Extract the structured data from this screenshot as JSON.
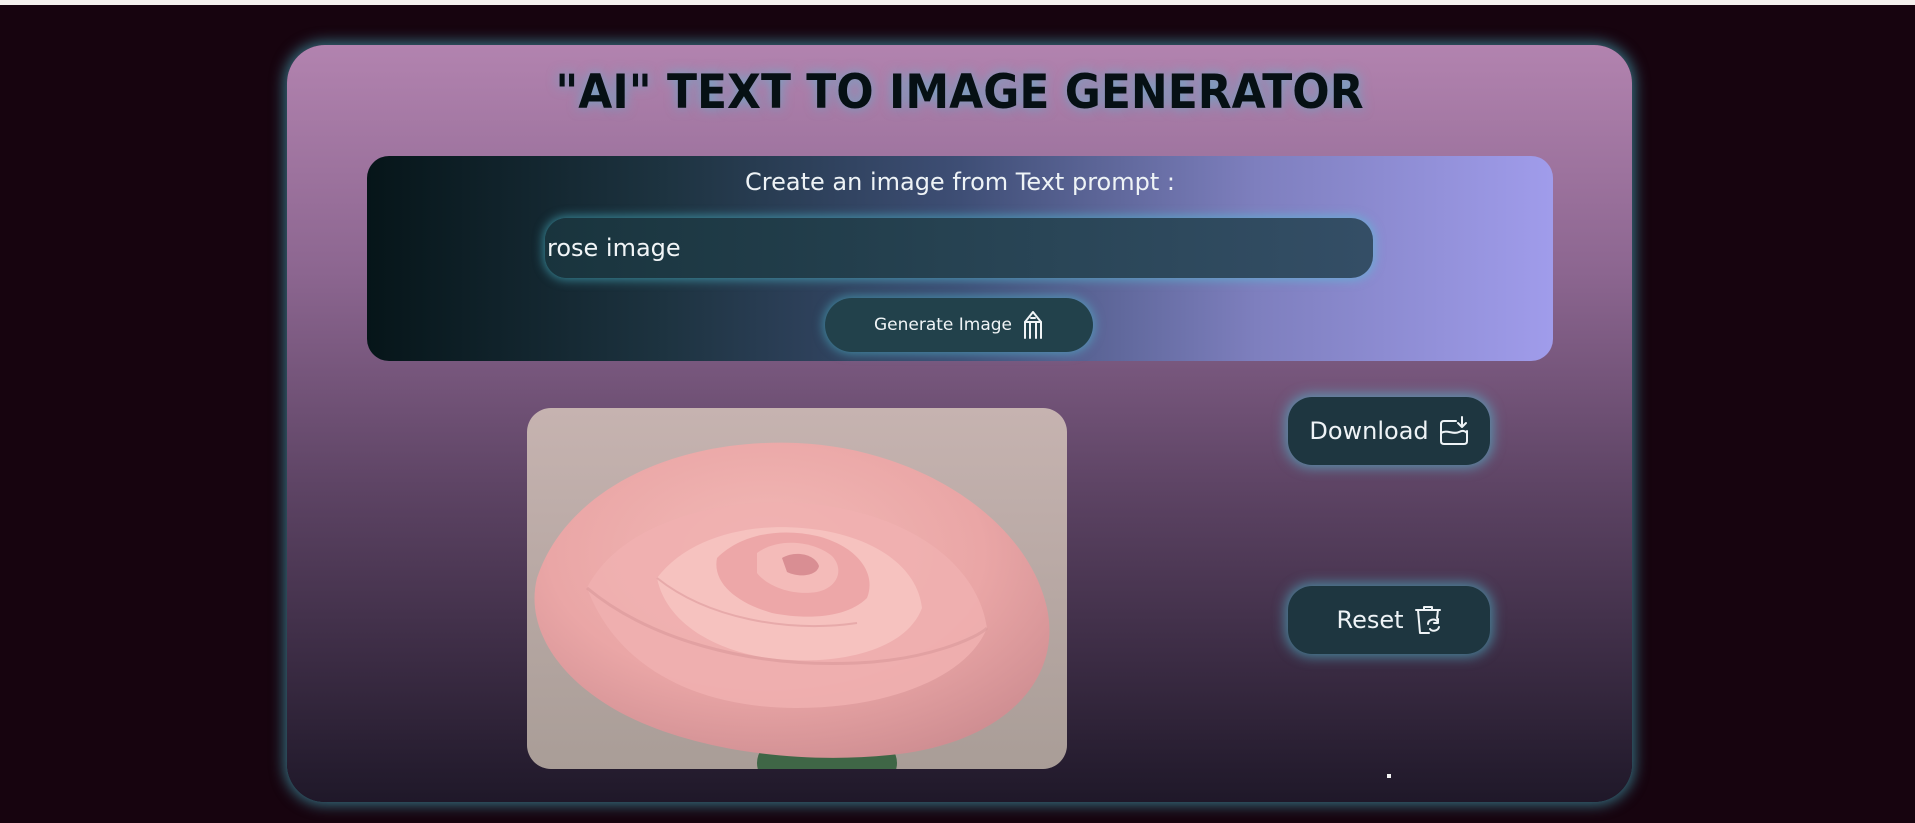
{
  "app": {
    "title": "\"AI\" TEXT TO IMAGE GENERATOR"
  },
  "prompt": {
    "label": "Create an image from Text prompt :",
    "value": "rose image",
    "placeholder": ""
  },
  "buttons": {
    "generate_label": "Generate Image",
    "download_label": "Download",
    "reset_label": "Reset"
  },
  "icons": {
    "generate": "pencil-icon",
    "download": "download-icon",
    "reset": "trash-refresh-icon"
  },
  "result": {
    "image_alt": "pink rose"
  },
  "colors": {
    "background": "#17040f",
    "glow": "#50c8dc",
    "button": "#1e3640"
  }
}
